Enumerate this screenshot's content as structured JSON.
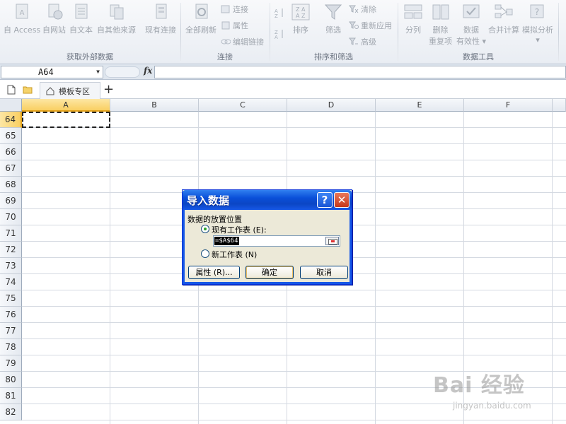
{
  "ribbon": {
    "groups": [
      {
        "label": "获取外部数据",
        "buttons": [
          "自 Access",
          "自网站",
          "自文本",
          "自其他来源",
          "现有连接"
        ]
      },
      {
        "label": "连接",
        "buttons": [
          "全部刷新"
        ],
        "small": [
          "连接",
          "属性",
          "编辑链接"
        ]
      },
      {
        "label": "排序和筛选",
        "buttons": [
          "排序",
          "筛选"
        ],
        "small": [
          "清除",
          "重新应用",
          "高级"
        ]
      },
      {
        "label": "数据工具",
        "buttons": [
          {
            "line1": "分列",
            "line2": ""
          },
          {
            "line1": "删除",
            "line2": "重复项"
          },
          {
            "line1": "数据",
            "line2": "有效性 ▾"
          },
          {
            "line1": "合并计算",
            "line2": ""
          },
          {
            "line1": "模拟分析",
            "line2": "▾"
          }
        ]
      }
    ]
  },
  "formula_bar": {
    "name_box": "A64",
    "fx_label": "fx",
    "formula": ""
  },
  "tabs": {
    "active": "模板专区"
  },
  "grid": {
    "columns": [
      "A",
      "B",
      "C",
      "D",
      "E",
      "F"
    ],
    "rows": [
      "64",
      "65",
      "66",
      "67",
      "68",
      "69",
      "70",
      "71",
      "72",
      "73",
      "74",
      "75",
      "76",
      "77",
      "78",
      "79",
      "80",
      "81",
      "82"
    ],
    "selected_cell": "A64"
  },
  "dialog": {
    "title": "导入数据",
    "help": "?",
    "close": "✕",
    "section_label": "数据的放置位置",
    "option_existing": "现有工作表 (E):",
    "option_new": "新工作表 (N)",
    "reference": "=$A$64",
    "properties_button": "属性 (R)...",
    "ok_button": "确定",
    "cancel_button": "取消"
  },
  "watermark": {
    "main": "Bai 经验",
    "sub": "jingyan.baidu.com"
  }
}
